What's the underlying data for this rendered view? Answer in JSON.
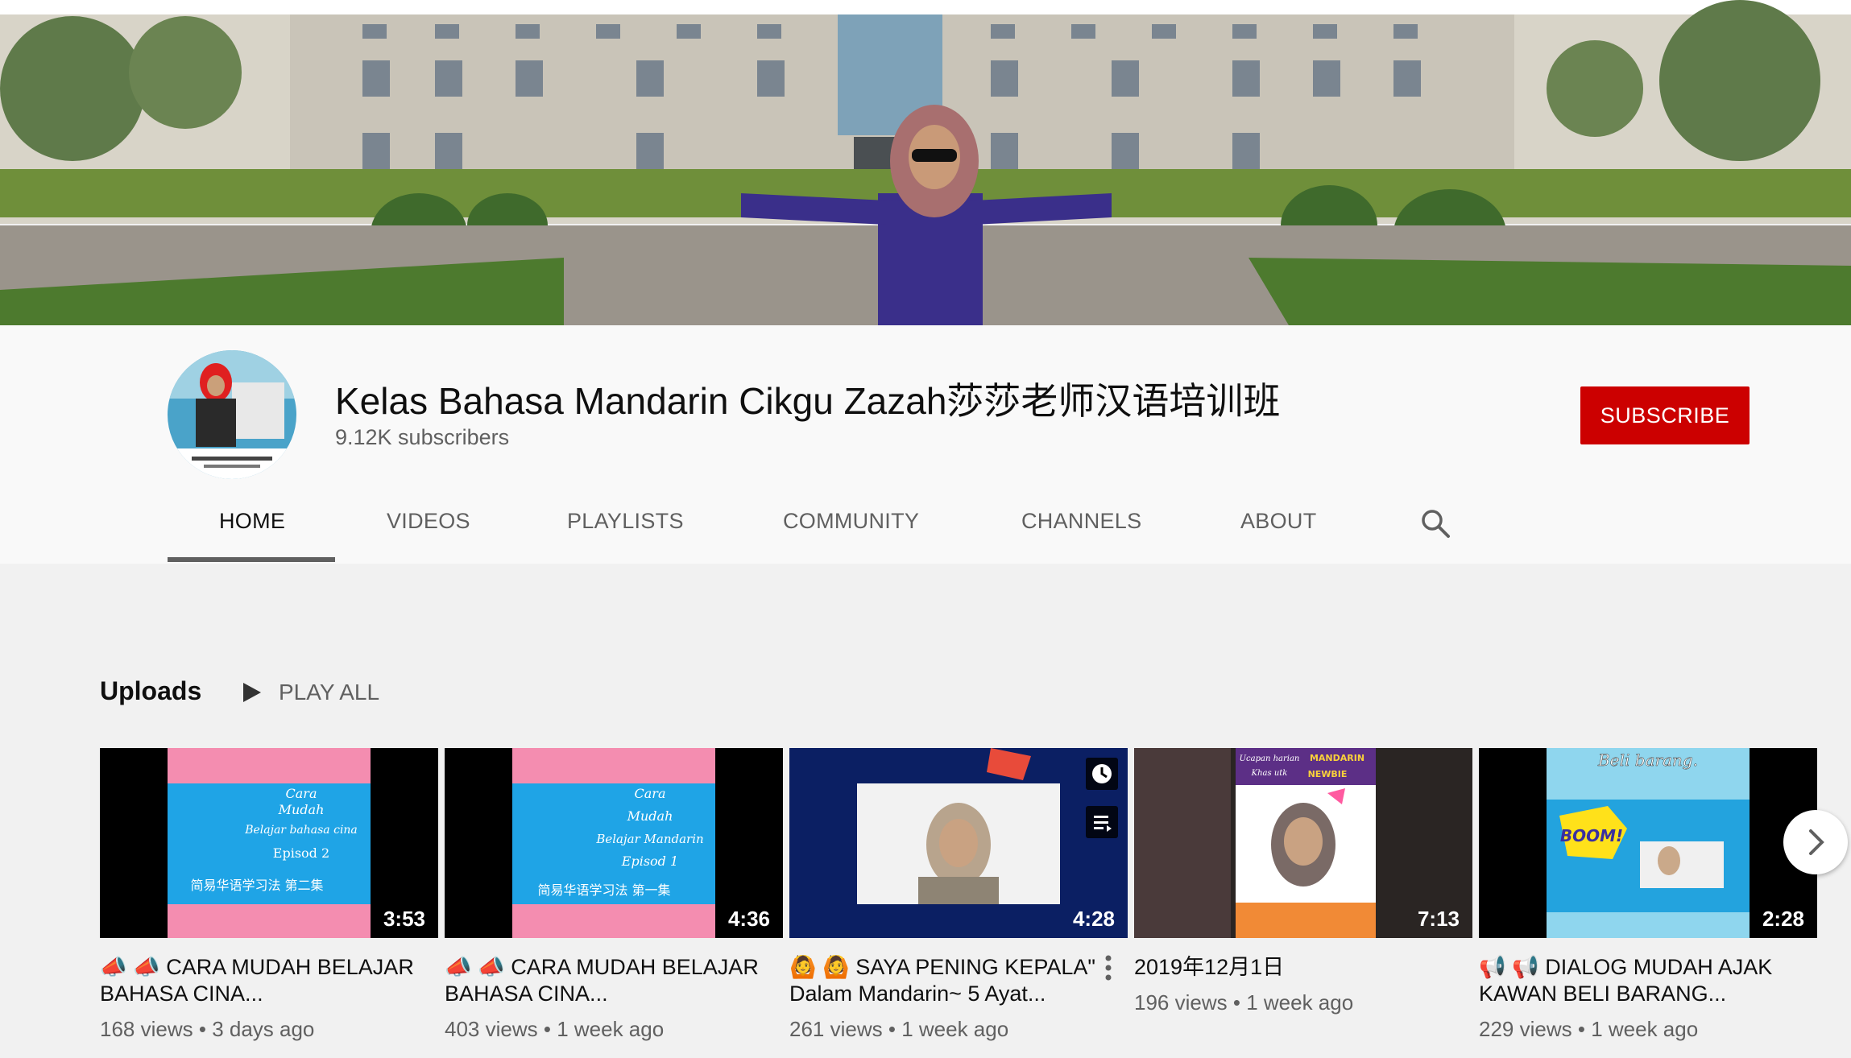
{
  "channel": {
    "name": "Kelas Bahasa Mandarin Cikgu Zazah莎莎老师汉语培训班",
    "subscribers": "9.12K subscribers",
    "subscribe_label": "SUBSCRIBE"
  },
  "tabs": [
    {
      "label": "HOME",
      "active": true
    },
    {
      "label": "VIDEOS"
    },
    {
      "label": "PLAYLISTS"
    },
    {
      "label": "COMMUNITY"
    },
    {
      "label": "CHANNELS"
    },
    {
      "label": "ABOUT"
    }
  ],
  "icons": {
    "search": "search-icon",
    "next": "chevron-right-icon",
    "watch_later": "clock-icon",
    "queue": "add-to-queue-icon",
    "more": "more-vert-icon"
  },
  "uploads": {
    "heading": "Uploads",
    "play_all": "PLAY ALL",
    "videos": [
      {
        "title": "📣 📣 CARA MUDAH BELAJAR BAHASA CINA...",
        "views": "168 views",
        "age": "3 days ago",
        "duration": "3:53",
        "thumb_text": [
          "Cara",
          "Mudah",
          "Belajar bahasa cina",
          "Episod 2",
          "简易华语学习法 第二集"
        ]
      },
      {
        "title": "📣 📣 CARA MUDAH BELAJAR BAHASA CINA...",
        "views": "403 views",
        "age": "1 week ago",
        "duration": "4:36",
        "thumb_text": [
          "Cara",
          "Mudah",
          "Belajar Mandarin",
          "Episod 1",
          "简易华语学习法 第一集"
        ]
      },
      {
        "title": "🙆 🙆 SAYA PENING KEPALA\" Dalam Mandarin~ 5 Ayat...",
        "views": "261 views",
        "age": "1 week ago",
        "duration": "4:28"
      },
      {
        "title": "2019年12月1日",
        "views": "196 views",
        "age": "1 week ago",
        "duration": "7:13",
        "thumb_text": [
          "Ucapan harian",
          "Khas utk",
          "MANDARIN",
          "NEWBIE"
        ]
      },
      {
        "title": "📢 📢 DIALOG MUDAH AJAK KAWAN BELI BARANG...",
        "views": "229 views",
        "age": "1 week ago",
        "duration": "2:28",
        "thumb_text": [
          "Beli barang.",
          "BOOM!"
        ]
      }
    ]
  },
  "colors": {
    "subscribe": "#cc0000",
    "meta": "#606060",
    "background": "#f1f1f1"
  }
}
